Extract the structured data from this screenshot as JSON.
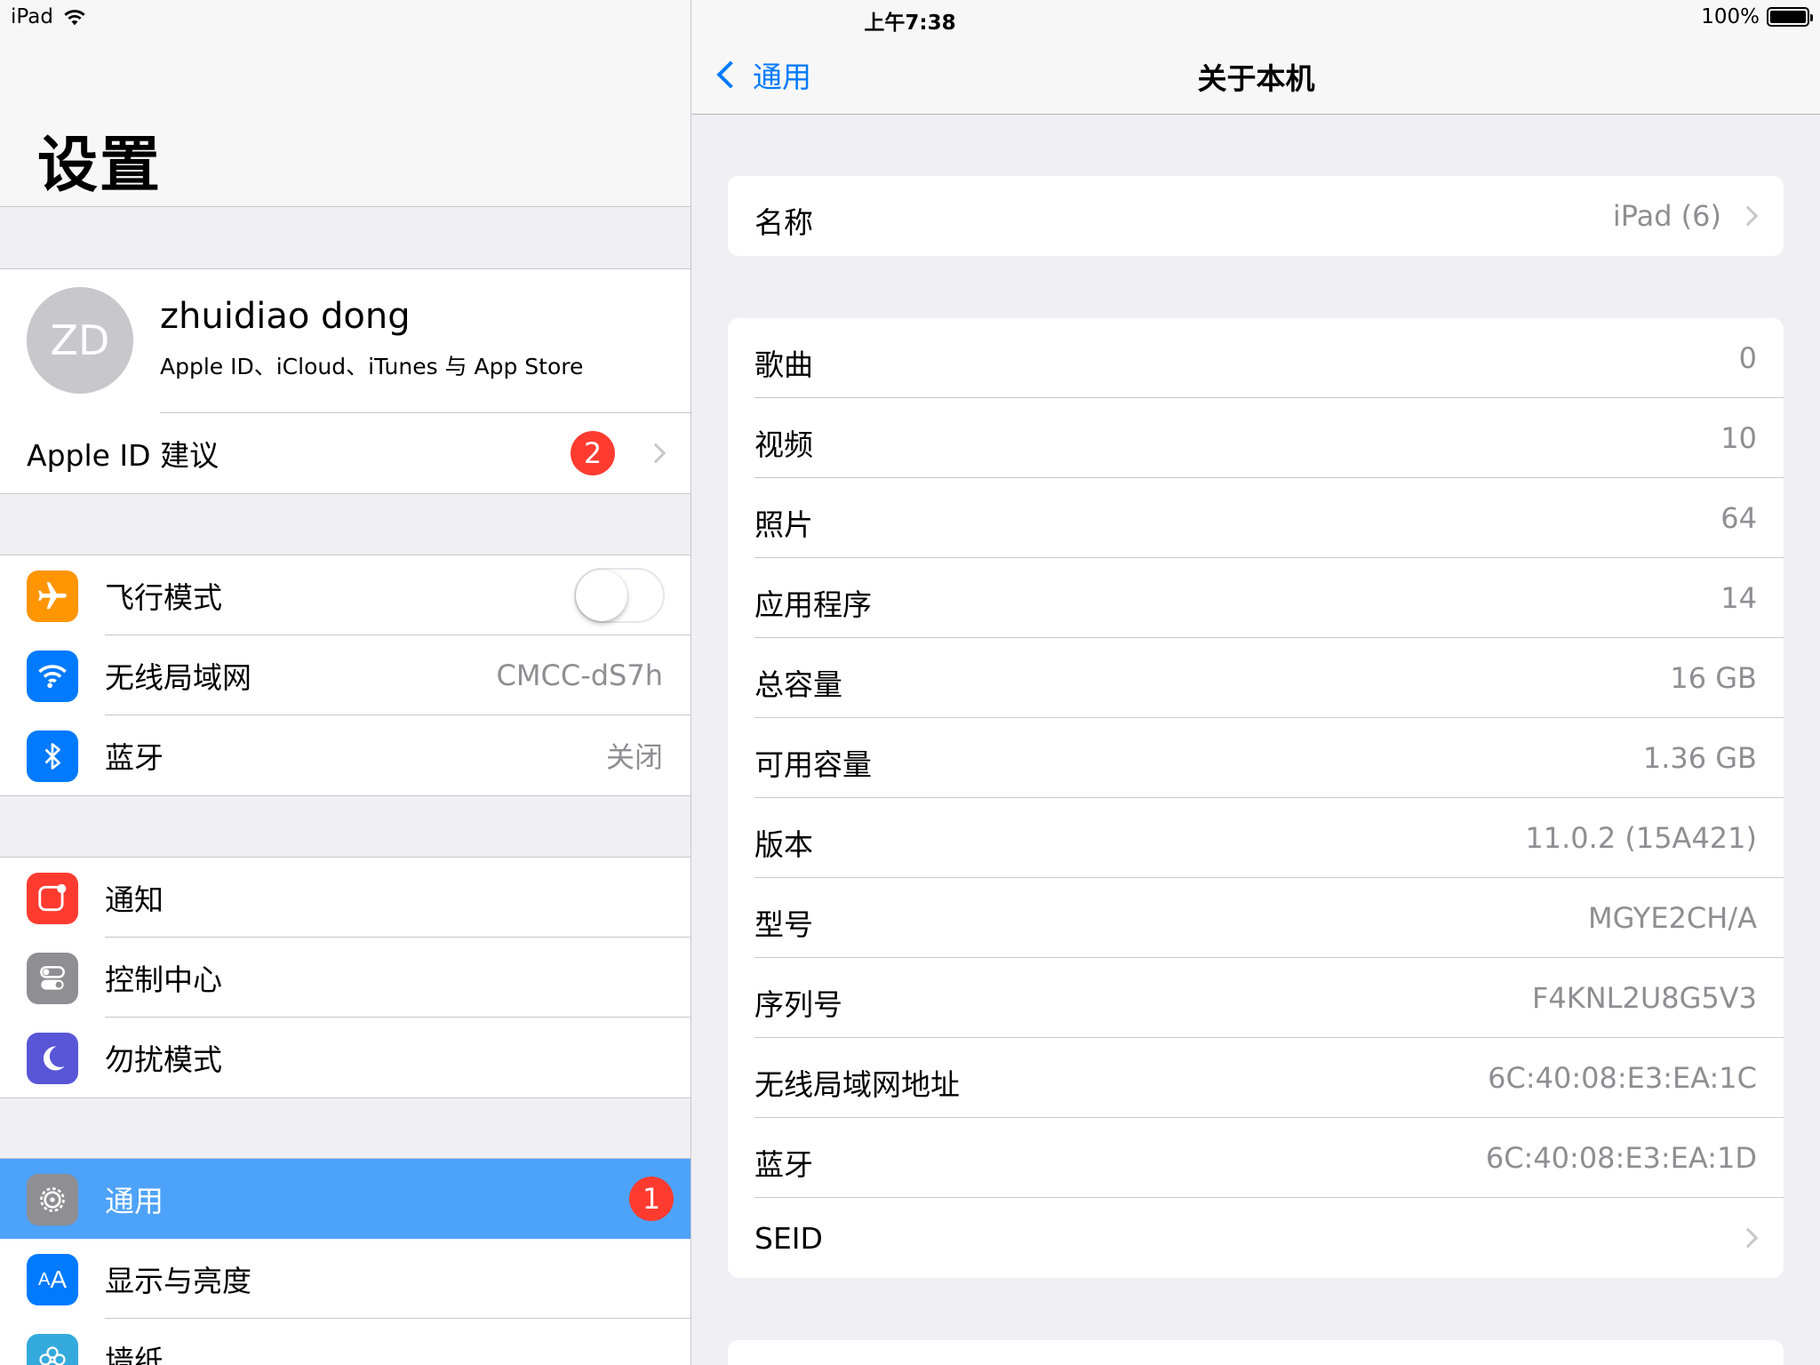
{
  "status_bar": {
    "device": "iPad",
    "time": "上午7:38",
    "battery": "100%"
  },
  "master": {
    "title": "设置",
    "profile": {
      "initials": "ZD",
      "name": "zhuidiao dong",
      "subtitle": "Apple ID、iCloud、iTunes 与 App Store"
    },
    "apple_id_suggestions": {
      "label": "Apple ID 建议",
      "badge": "2"
    },
    "connectivity": [
      {
        "label": "飞行模式",
        "icon": "airplane-icon",
        "color": "#ff9500",
        "toggle": false
      },
      {
        "label": "无线局域网",
        "icon": "wifi-icon",
        "color": "#007aff",
        "value": "CMCC-dS7h"
      },
      {
        "label": "蓝牙",
        "icon": "bluetooth-icon",
        "color": "#007aff",
        "value": "关闭"
      }
    ],
    "system": [
      {
        "label": "通知",
        "icon": "notifications-icon",
        "color": "#ff3b30"
      },
      {
        "label": "控制中心",
        "icon": "control-center-icon",
        "color": "#8e8e93"
      },
      {
        "label": "勿扰模式",
        "icon": "moon-icon",
        "color": "#5856d6"
      }
    ],
    "general_group": [
      {
        "label": "通用",
        "icon": "gear-icon",
        "color": "#8e8e93",
        "badge": "1",
        "selected": true
      },
      {
        "label": "显示与亮度",
        "icon": "display-icon",
        "color": "#007aff"
      },
      {
        "label": "墙纸",
        "icon": "wallpaper-icon",
        "color": "#34aadc"
      }
    ]
  },
  "detail": {
    "back_label": "通用",
    "title": "关于本机",
    "name_row": {
      "label": "名称",
      "value": "iPad (6)"
    },
    "info_rows": [
      {
        "label": "歌曲",
        "value": "0"
      },
      {
        "label": "视频",
        "value": "10"
      },
      {
        "label": "照片",
        "value": "64"
      },
      {
        "label": "应用程序",
        "value": "14"
      },
      {
        "label": "总容量",
        "value": "16 GB"
      },
      {
        "label": "可用容量",
        "value": "1.36 GB"
      },
      {
        "label": "版本",
        "value": "11.0.2 (15A421)"
      },
      {
        "label": "型号",
        "value": "MGYE2CH/A"
      },
      {
        "label": "序列号",
        "value": "F4KNL2U8G5V3"
      },
      {
        "label": "无线局域网地址",
        "value": "6C:40:08:E3:EA:1C"
      },
      {
        "label": "蓝牙",
        "value": "6C:40:08:E3:EA:1D"
      },
      {
        "label": "SEID",
        "value": ""
      }
    ]
  }
}
